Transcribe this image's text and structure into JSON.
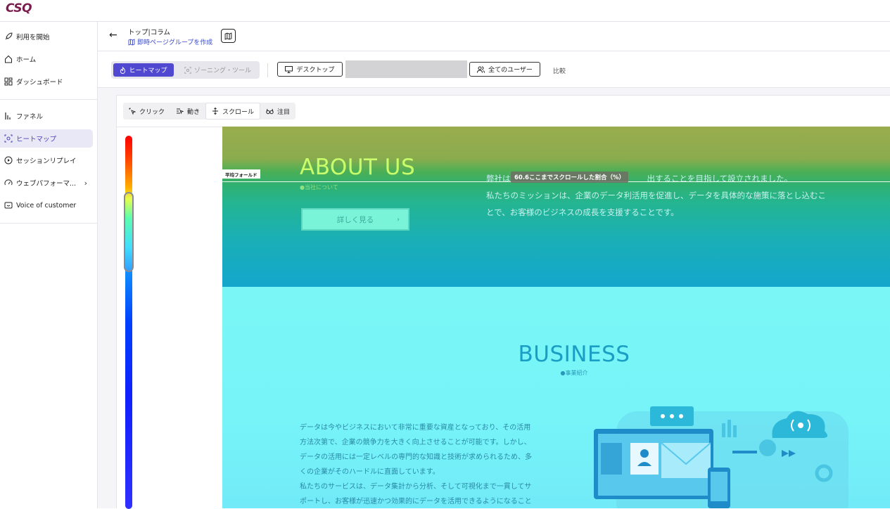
{
  "app": {
    "logo": "CSQ"
  },
  "sidebar": {
    "items": [
      {
        "label": "利用を開始",
        "icon": "rocket-icon"
      },
      {
        "label": "ホーム",
        "icon": "home-icon"
      },
      {
        "label": "ダッシュボード",
        "icon": "dashboard-icon"
      },
      {
        "label": "ファネル",
        "icon": "funnel-icon"
      },
      {
        "label": "ヒートマップ",
        "icon": "heatmap-icon",
        "active": true
      },
      {
        "label": "セッションリプレイ",
        "icon": "play-icon"
      },
      {
        "label": "ウェブパフォーマ...",
        "icon": "gauge-icon",
        "has_submenu": true
      },
      {
        "label": "Voice of customer",
        "icon": "feedback-icon"
      }
    ]
  },
  "header": {
    "title": "トップ|コラム",
    "sublink": "即時ページグループを作成"
  },
  "toolbar": {
    "heatmap_label": "ヒートマップ",
    "zoning_label": "ゾーニング・ツール",
    "device_label": "デスクトップ",
    "users_label": "全てのユーザー",
    "compare_label": "比較"
  },
  "modes": {
    "click": "クリック",
    "move": "動き",
    "scroll": "スクロール",
    "attention": "注目"
  },
  "heatmap": {
    "fold_label": "平均フォールド",
    "scroll_tooltip": "60.6ここまでスクロールした割合（%）",
    "about_title": "ABOUT US",
    "about_sub": "●当社について",
    "about_button": "詳しく見る",
    "about_text_1": "弊社は",
    "about_text_1b": "出することを目指して設立されました。",
    "about_text_2": "私たちのミッションは、企業のデータ利活用を促進し、データを具体的な施策に落とし込むこ",
    "about_text_3": "とで、お客様のビジネスの成長を支援することです。",
    "business_title": "BUSINESS",
    "business_sub": "●事業紹介",
    "business_text_1": "データは今やビジネスにおいて非常に重要な資産となっており、その活用",
    "business_text_2": "方法次第で、企業の競争力を大きく向上させることが可能です。しかし、",
    "business_text_3": "データの活用には一定レベルの専門的な知識と技術が求められるため、多",
    "business_text_4": "くの企業がそのハードルに直面しています。",
    "business_text_5": "私たちのサービスは、データ集計から分析、そして可視化まで一貫してサ",
    "business_text_6": "ポートし、お客様が迅速かつ効果的にデータを活用できるようになること"
  },
  "colors": {
    "accent": "#5048d0",
    "active_nav_bg": "#e8e8f6",
    "logo": "#7a1c4e"
  }
}
